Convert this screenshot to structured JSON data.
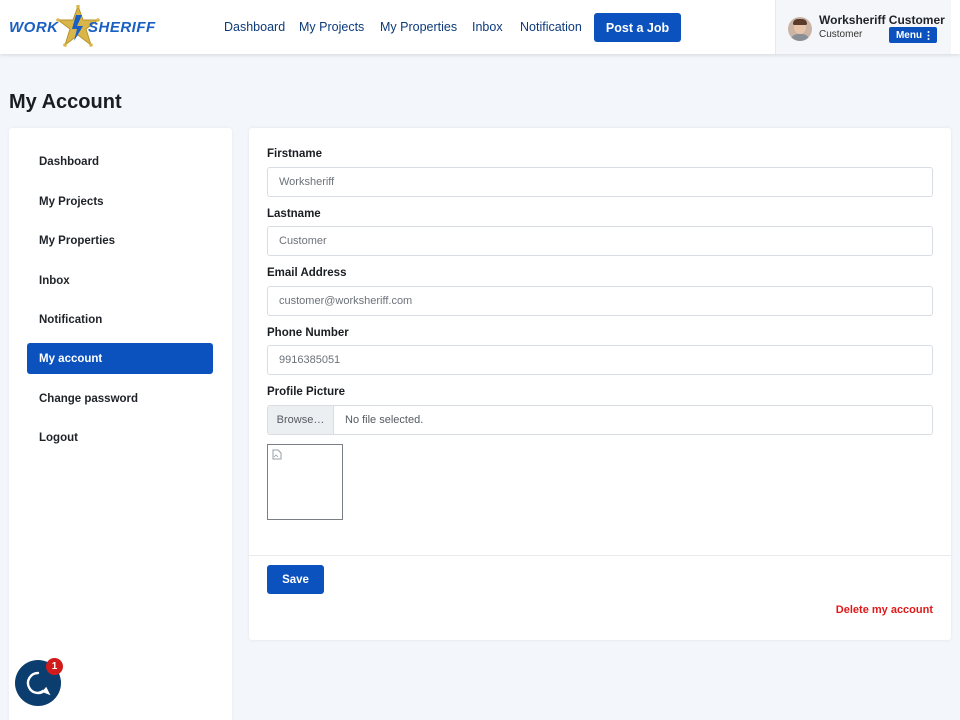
{
  "brand": {
    "logo_left": "WORK",
    "logo_right": "SHERIFF",
    "colors": {
      "primary": "#0b52bf",
      "logo_star": "#d9b64a",
      "danger": "#e01818"
    }
  },
  "nav": {
    "items": [
      {
        "label": "Dashboard"
      },
      {
        "label": "My Projects"
      },
      {
        "label": "My Properties"
      },
      {
        "label": "Inbox"
      },
      {
        "label": "Notification"
      }
    ],
    "post_job_label": "Post a Job"
  },
  "user": {
    "name": "Worksheriff Customer",
    "role": "Customer",
    "menu_label": "Menu",
    "menu_icon": "kebab-icon"
  },
  "page": {
    "title": "My Account"
  },
  "sidebar": {
    "items": [
      {
        "label": "Dashboard",
        "active": false
      },
      {
        "label": "My Projects",
        "active": false
      },
      {
        "label": "My Properties",
        "active": false
      },
      {
        "label": "Inbox",
        "active": false
      },
      {
        "label": "Notification",
        "active": false
      },
      {
        "label": "My account",
        "active": true
      },
      {
        "label": "Change password",
        "active": false
      },
      {
        "label": "Logout",
        "active": false
      }
    ]
  },
  "form": {
    "firstname": {
      "label": "Firstname",
      "value": "Worksheriff"
    },
    "lastname": {
      "label": "Lastname",
      "value": "Customer"
    },
    "email": {
      "label": "Email Address",
      "value": "customer@worksheriff.com"
    },
    "phone": {
      "label": "Phone Number",
      "value": "9916385051"
    },
    "picture": {
      "label": "Profile Picture",
      "browse_label": "Browse…",
      "file_status": "No file selected."
    },
    "save_label": "Save",
    "delete_label": "Delete my account"
  },
  "chat": {
    "icon": "chat-bubble-icon",
    "badge_count": "1"
  }
}
